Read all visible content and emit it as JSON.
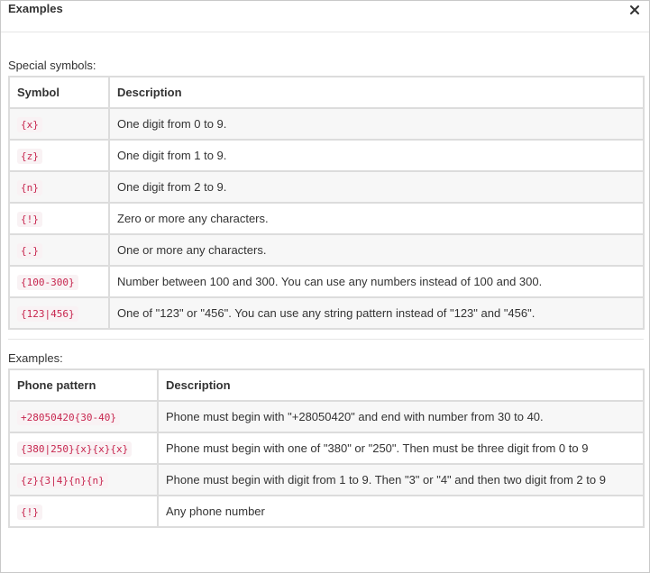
{
  "dialog": {
    "title": "Examples",
    "close_icon": "close-icon"
  },
  "special_symbols": {
    "label": "Special symbols:",
    "headers": [
      "Symbol",
      "Description"
    ],
    "rows": [
      {
        "symbol": "{x}",
        "description": "One digit from 0 to 9."
      },
      {
        "symbol": "{z}",
        "description": "One digit from 1 to 9."
      },
      {
        "symbol": "{n}",
        "description": "One digit from 2 to 9."
      },
      {
        "symbol": "{!}",
        "description": "Zero or more any characters."
      },
      {
        "symbol": "{.}",
        "description": "One or more any characters."
      },
      {
        "symbol": "{100-300}",
        "description": "Number between 100 and 300. You can use any numbers instead of 100 and 300."
      },
      {
        "symbol": "{123|456}",
        "description": "One of \"123\" or \"456\". You can use any string pattern instead of \"123\" and \"456\"."
      }
    ]
  },
  "examples": {
    "label": "Examples:",
    "headers": [
      "Phone pattern",
      "Description"
    ],
    "rows": [
      {
        "pattern": "+28050420{30-40}",
        "description": "Phone must begin with \"+28050420\" and end with number from 30 to 40."
      },
      {
        "pattern": "{380|250}{x}{x}{x}",
        "description": "Phone must begin with one of \"380\" or \"250\". Then must be three digit from 0 to 9"
      },
      {
        "pattern": "{z}{3|4}{n}{n}",
        "description": "Phone must begin with digit from 1 to 9. Then \"3\" or \"4\" and then two digit from 2 to 9"
      },
      {
        "pattern": "{!}",
        "description": "Any phone number"
      }
    ]
  },
  "colors": {
    "code_text": "#c7254e",
    "code_background": "#f9f2f4",
    "table_border": "#dcdcdc",
    "striped_row": "#f7f7f7"
  }
}
